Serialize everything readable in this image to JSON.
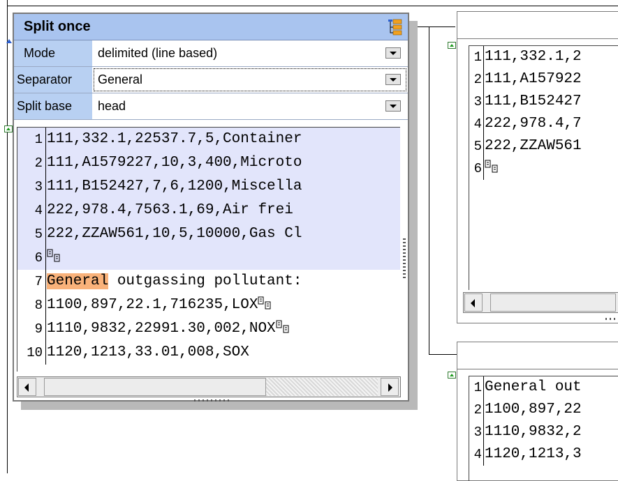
{
  "component": {
    "title": "Split once",
    "properties": [
      {
        "label": "Mode",
        "value": "delimited (line based)"
      },
      {
        "label": "Separator",
        "value": "General"
      },
      {
        "label": "Split base",
        "value": "head"
      }
    ],
    "lines": [
      {
        "n": "1",
        "text": "111,332.1,22537.7,5,Container"
      },
      {
        "n": "2",
        "text": "111,A1579227,10,3,400,Microto"
      },
      {
        "n": "3",
        "text": "111,B152427,7,6,1200,Miscella"
      },
      {
        "n": "4",
        "text": "222,978.4,7563.1,69,Air frei"
      },
      {
        "n": "5",
        "text": "222,ZZAW561,10,5,10000,Gas Cl"
      },
      {
        "n": "6",
        "text": ""
      },
      {
        "n": "7",
        "sep": "General",
        "text": " outgassing pollutant:"
      },
      {
        "n": "8",
        "text": "1100,897,22.1,716235,LOX"
      },
      {
        "n": "9",
        "text": "1110,9832,22991.30,002,NOX"
      },
      {
        "n": "10",
        "text": "1120,1213,33.01,008,SOX"
      }
    ]
  },
  "output_top": {
    "lines": [
      {
        "n": "1",
        "text": "111,332.1,2"
      },
      {
        "n": "2",
        "text": "111,A157922"
      },
      {
        "n": "3",
        "text": "111,B152427"
      },
      {
        "n": "4",
        "text": "222,978.4,7"
      },
      {
        "n": "5",
        "text": "222,ZZAW561"
      },
      {
        "n": "6",
        "text": ""
      }
    ]
  },
  "output_bottom": {
    "lines": [
      {
        "n": "1",
        "text": "General out"
      },
      {
        "n": "2",
        "text": "1100,897,22"
      },
      {
        "n": "3",
        "text": "1110,9832,2"
      },
      {
        "n": "4",
        "text": "1120,1213,3"
      }
    ]
  },
  "colors": {
    "title_bar": "#a9c4ef",
    "highlight": "#e2e5fb",
    "separator_match": "#f9b27a"
  }
}
